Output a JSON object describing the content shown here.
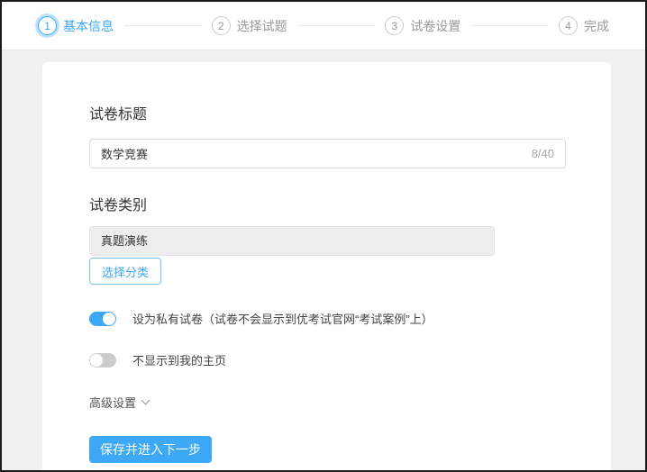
{
  "steps": [
    {
      "num": "1",
      "label": "基本信息",
      "state": "active"
    },
    {
      "num": "2",
      "label": "选择试题",
      "state": "pending"
    },
    {
      "num": "3",
      "label": "试卷设置",
      "state": "pending"
    },
    {
      "num": "4",
      "label": "完成",
      "state": "pending"
    }
  ],
  "form": {
    "title_label": "试卷标题",
    "title_value": "数学竞赛",
    "title_counter": "8/40",
    "category_label": "试卷类别",
    "category_value": "真题演练",
    "choose_category_button": "选择分类",
    "private_toggle_label": "设为私有试卷（试卷不会显示到优考试官网“考试案例”上）",
    "private_toggle_state": "on",
    "homepage_toggle_label": "不显示到我的主页",
    "homepage_toggle_state": "off",
    "advanced_settings_label": "高级设置",
    "save_button_label": "保存并进入下一步"
  },
  "colors": {
    "accent_blue": "#3da8f5",
    "toggle_off_gray": "#cccccc",
    "card_background": "#ffffff",
    "page_background": "#f0f0f0"
  }
}
